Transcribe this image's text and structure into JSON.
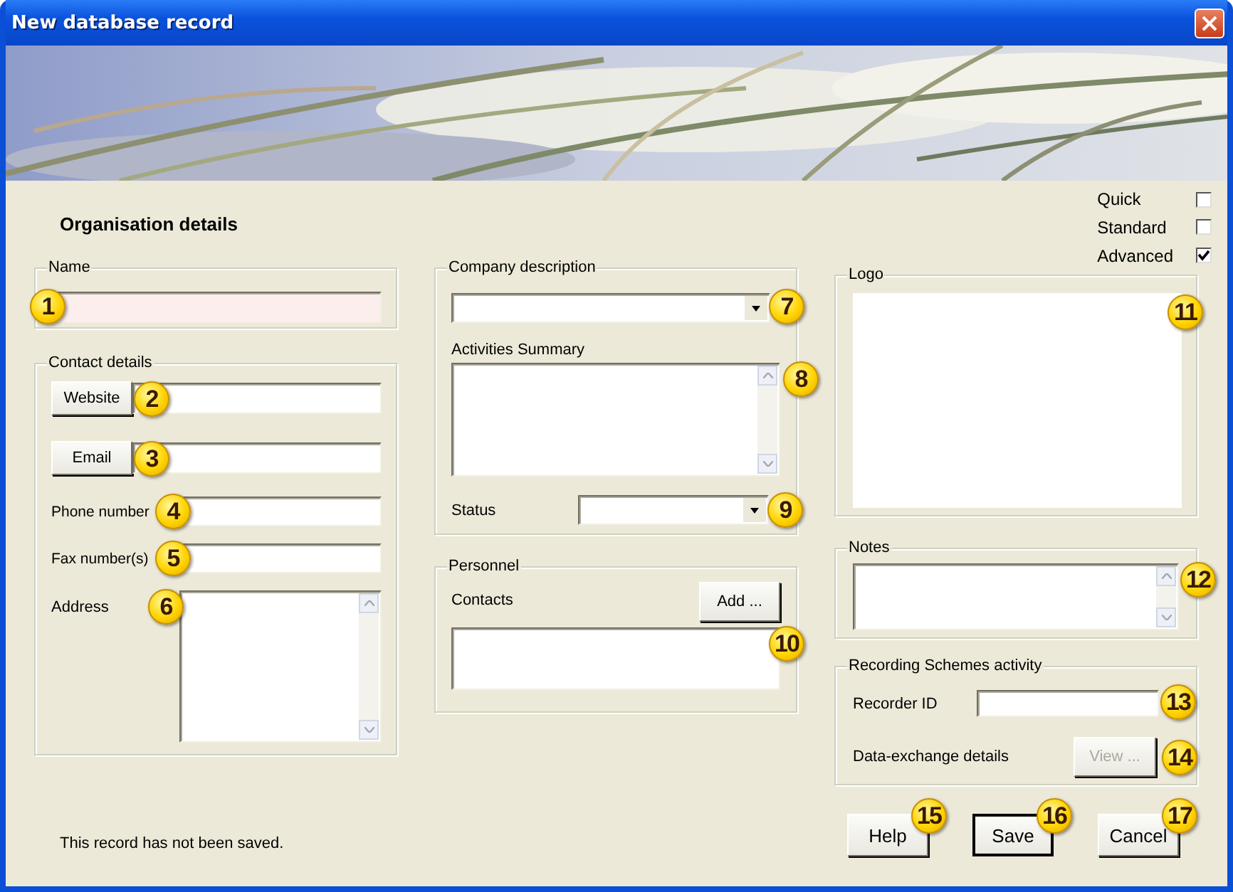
{
  "window": {
    "title": "New database record"
  },
  "heading": "Organisation details",
  "modes": [
    {
      "label": "Quick",
      "checked": false
    },
    {
      "label": "Standard",
      "checked": false
    },
    {
      "label": "Advanced",
      "checked": true
    }
  ],
  "name_group": {
    "legend": "Name",
    "highlighted": true,
    "callout": "1"
  },
  "contact_details": {
    "legend": "Contact details",
    "rows": [
      {
        "kind": "button",
        "label": "Website",
        "callout": "2"
      },
      {
        "kind": "button",
        "label": "Email",
        "callout": "3"
      },
      {
        "kind": "label",
        "label": "Phone number",
        "callout": "4"
      },
      {
        "kind": "label",
        "label": "Fax number(s)",
        "callout": "5"
      },
      {
        "kind": "memo",
        "label": "Address",
        "callout": "6"
      }
    ]
  },
  "company_description": {
    "legend": "Company description",
    "dropdown_callout": "7",
    "activities_label": "Activities Summary",
    "activities_callout": "8",
    "status_label": "Status",
    "status_callout": "9"
  },
  "personnel": {
    "legend": "Personnel",
    "label": "Contacts",
    "button": "Add ...",
    "callout": "10"
  },
  "logo": {
    "legend": "Logo",
    "callout": "11"
  },
  "notes": {
    "legend": "Notes",
    "callout": "12"
  },
  "recording": {
    "legend": "Recording Schemes activity",
    "recorder_label": "Recorder ID",
    "recorder_callout": "13",
    "exchange_label": "Data-exchange details",
    "view_button": {
      "label": "View ...",
      "disabled": true
    },
    "callout": "14"
  },
  "status": "This record has not been saved.",
  "buttons": [
    {
      "label": "Help",
      "default": false,
      "callout": "15"
    },
    {
      "label": "Save",
      "default": true,
      "callout": "16"
    },
    {
      "label": "Cancel",
      "default": false,
      "callout": "17"
    }
  ]
}
